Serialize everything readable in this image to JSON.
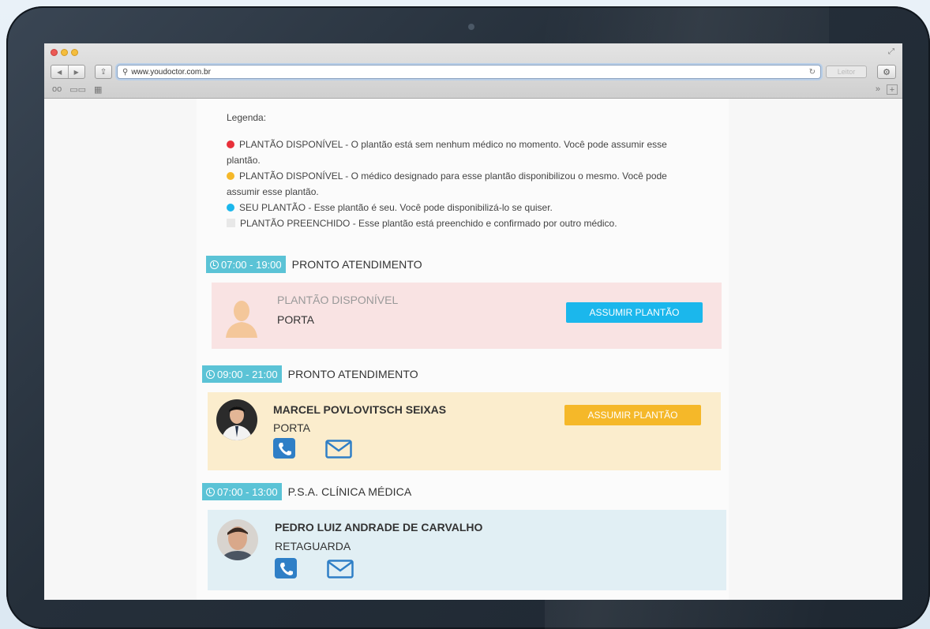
{
  "browser": {
    "url": "www.youdoctor.com.br",
    "reader_label": "Leitor"
  },
  "legend": {
    "title": "Legenda:",
    "items": [
      {
        "color": "#e8303a",
        "text": "PLANTÃO DISPONÍVEL - O plantão está sem nenhum médico no momento. Você pode assumir esse plantão."
      },
      {
        "color": "#f5b829",
        "text": "PLANTÃO DISPONÍVEL - O médico designado para esse plantão disponibilizou o mesmo. Você pode assumir esse plantão."
      },
      {
        "color": "#1bb7ec",
        "text": "SEU PLANTÃO - Esse plantão é seu. Você pode disponibilizá-lo se quiser."
      },
      {
        "color": "#e8e8e8",
        "text": "PLANTÃO PREENCHIDO - Esse plantão está preenchido e confirmado por outro médico."
      }
    ]
  },
  "shifts": [
    {
      "time": "07:00 - 19:00",
      "department": "PRONTO ATENDIMENTO",
      "status_label": "PLANTÃO DISPONÍVEL",
      "role": "PORTA",
      "button": "ASSUMIR PLANTÃO"
    },
    {
      "time": "09:00 - 21:00",
      "department": "PRONTO ATENDIMENTO",
      "doctor": "MARCEL POVLOVITSCH SEIXAS",
      "role": "PORTA",
      "button": "ASSUMIR PLANTÃO"
    },
    {
      "time": "07:00 - 13:00",
      "department": "P.S.A. CLÍNICA MÉDICA",
      "doctor": "PEDRO LUIZ ANDRADE DE CARVALHO",
      "role": "RETAGUARDA"
    }
  ],
  "colors": {
    "accent_blue": "#1bb7ec",
    "accent_yellow": "#f5b829",
    "badge": "#5bc3d6",
    "icon_blue": "#2f7fc6"
  }
}
